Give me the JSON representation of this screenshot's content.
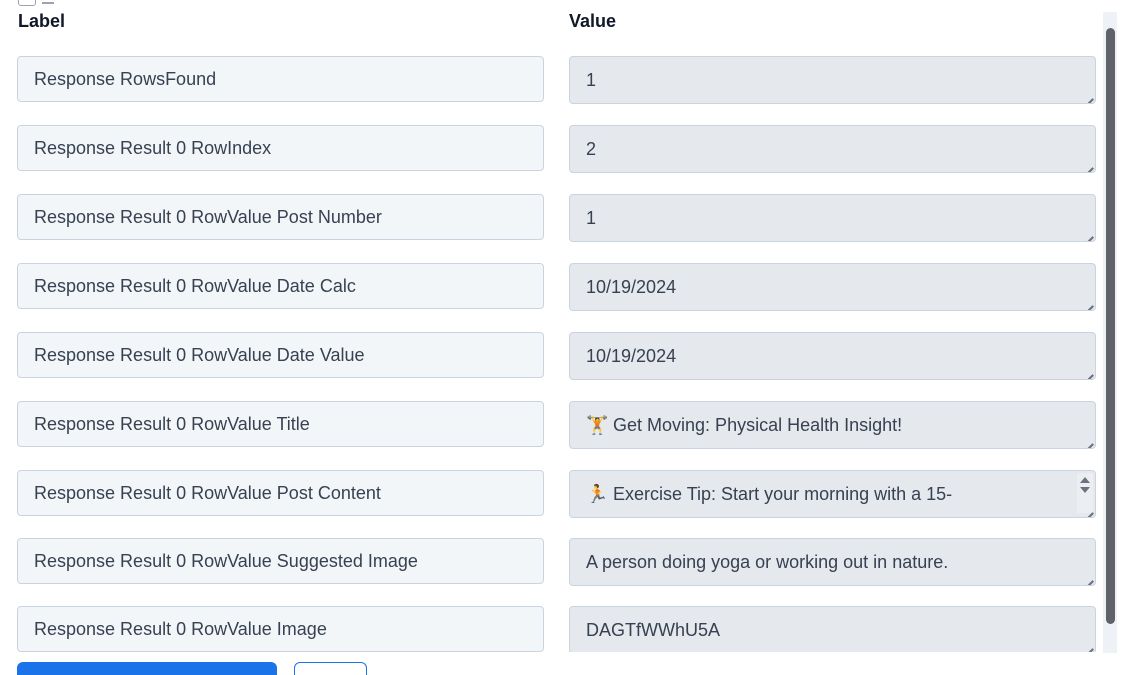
{
  "headers": {
    "label": "Label",
    "value": "Value"
  },
  "rows": [
    {
      "label": "Response RowsFound",
      "value": "1"
    },
    {
      "label": "Response Result 0 RowIndex",
      "value": "2"
    },
    {
      "label": "Response Result 0 RowValue Post Number",
      "value": "1"
    },
    {
      "label": "Response Result 0 RowValue Date Calc",
      "value": "10/19/2024"
    },
    {
      "label": "Response Result 0 RowValue Date Value",
      "value": "10/19/2024"
    },
    {
      "label": "Response Result 0 RowValue Title",
      "value": "Get Moving: Physical Health Insight!",
      "icon": "🏋"
    },
    {
      "label": "Response Result 0 RowValue Post Content",
      "value": "Exercise Tip: Start your morning with a 15-",
      "icon": "🏃"
    },
    {
      "label": "Response Result 0 RowValue Suggested Image",
      "value": "A person doing yoga or working out in nature."
    },
    {
      "label": "Response Result 0 RowValue Image",
      "value": "DAGTfWWhU5A"
    }
  ],
  "icons": {
    "title_value": "weightlifter-emoji-icon",
    "post_content_value": "runner-emoji-icon"
  }
}
